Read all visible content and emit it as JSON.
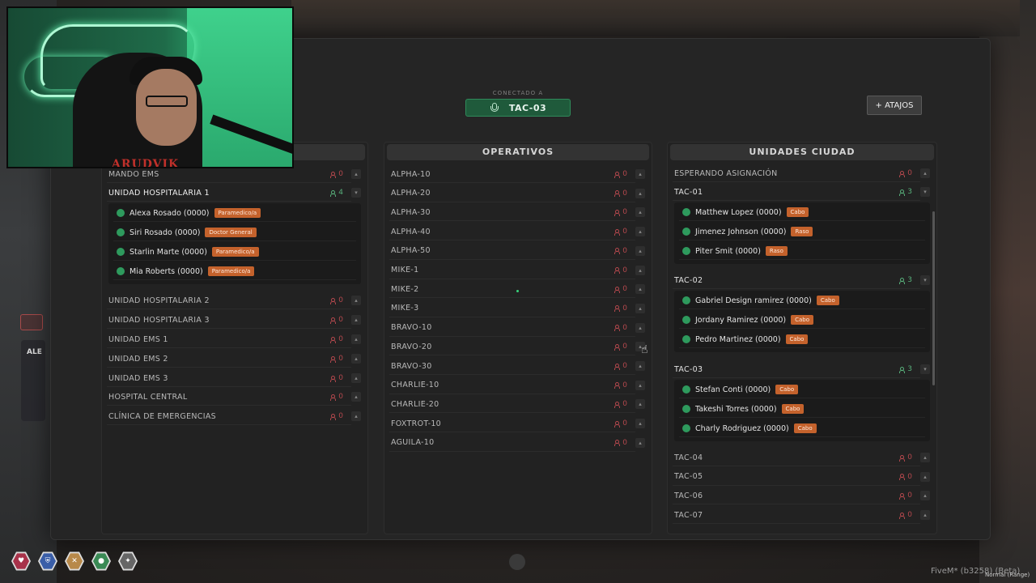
{
  "connected_label": "CONECTADO A",
  "connected_channel": "TAC-03",
  "atajos_label": "+ ATAJOS",
  "left_column": {
    "rows": [
      {
        "name": "MANDO EMS",
        "count": "0"
      },
      {
        "name": "UNIDAD HOSPITALARIA 1",
        "count": "4",
        "active": true
      },
      {
        "name": "UNIDAD HOSPITALARIA 2",
        "count": "0"
      },
      {
        "name": "UNIDAD HOSPITALARIA 3",
        "count": "0"
      },
      {
        "name": "UNIDAD EMS 1",
        "count": "0"
      },
      {
        "name": "UNIDAD EMS 2",
        "count": "0"
      },
      {
        "name": "UNIDAD EMS 3",
        "count": "0"
      },
      {
        "name": "HOSPITAL CENTRAL",
        "count": "0"
      },
      {
        "name": "CLÍNICA DE EMERGENCIAS",
        "count": "0"
      }
    ],
    "members": [
      {
        "name": "Alexa Rosado (0000)",
        "role": "Paramedico/a"
      },
      {
        "name": "Siri Rosado (0000)",
        "role": "Doctor General"
      },
      {
        "name": "Starlin Marte (0000)",
        "role": "Paramedico/a"
      },
      {
        "name": "Mia Roberts (0000)",
        "role": "Paramedico/a"
      }
    ]
  },
  "middle_column": {
    "header": "OPERATIVOS",
    "rows": [
      {
        "name": "ALPHA-10",
        "count": "0"
      },
      {
        "name": "ALPHA-20",
        "count": "0"
      },
      {
        "name": "ALPHA-30",
        "count": "0"
      },
      {
        "name": "ALPHA-40",
        "count": "0"
      },
      {
        "name": "ALPHA-50",
        "count": "0"
      },
      {
        "name": "MIKE-1",
        "count": "0"
      },
      {
        "name": "MIKE-2",
        "count": "0"
      },
      {
        "name": "MIKE-3",
        "count": "0"
      },
      {
        "name": "BRAVO-10",
        "count": "0"
      },
      {
        "name": "BRAVO-20",
        "count": "0"
      },
      {
        "name": "BRAVO-30",
        "count": "0"
      },
      {
        "name": "CHARLIE-10",
        "count": "0"
      },
      {
        "name": "CHARLIE-20",
        "count": "0"
      },
      {
        "name": "FOXTROT-10",
        "count": "0"
      },
      {
        "name": "AGUILA-10",
        "count": "0"
      }
    ]
  },
  "right_column": {
    "header": "UNIDADES CIUDAD",
    "waiting": {
      "name": "ESPERANDO ASIGNACIÓN",
      "count": "0"
    },
    "tac01": {
      "name": "TAC-01",
      "count": "3",
      "members": [
        {
          "name": "Matthew Lopez (0000)",
          "role": "Cabo"
        },
        {
          "name": "Jimenez Johnson (0000)",
          "role": "Raso"
        },
        {
          "name": "Piter Smit (0000)",
          "role": "Raso"
        }
      ]
    },
    "tac02": {
      "name": "TAC-02",
      "count": "3",
      "members": [
        {
          "name": "Gabriel Design ramirez (0000)",
          "role": "Cabo"
        },
        {
          "name": "Jordany Ramirez (0000)",
          "role": "Cabo"
        },
        {
          "name": "Pedro Martinez (0000)",
          "role": "Cabo"
        }
      ]
    },
    "tac03": {
      "name": "TAC-03",
      "count": "3",
      "members": [
        {
          "name": "Stefan Conti (0000)",
          "role": "Cabo"
        },
        {
          "name": "Takeshi Torres (0000)",
          "role": "Cabo"
        },
        {
          "name": "Charly Rodriguez (0000)",
          "role": "Cabo"
        }
      ]
    },
    "rows": [
      {
        "name": "TAC-04",
        "count": "0"
      },
      {
        "name": "TAC-05",
        "count": "0"
      },
      {
        "name": "TAC-06",
        "count": "0"
      },
      {
        "name": "TAC-07",
        "count": "0"
      }
    ]
  },
  "webcam_shirt_text": "ARUDVIK",
  "left_widget_text": "ALE",
  "footer": {
    "fivem": "FiveM* (b3258) (Beta)",
    "right": "Normal (Range)"
  },
  "colors": {
    "accent_green": "#2e9a5d",
    "badge_orange": "#c4622c",
    "count_red": "#b4484d"
  }
}
